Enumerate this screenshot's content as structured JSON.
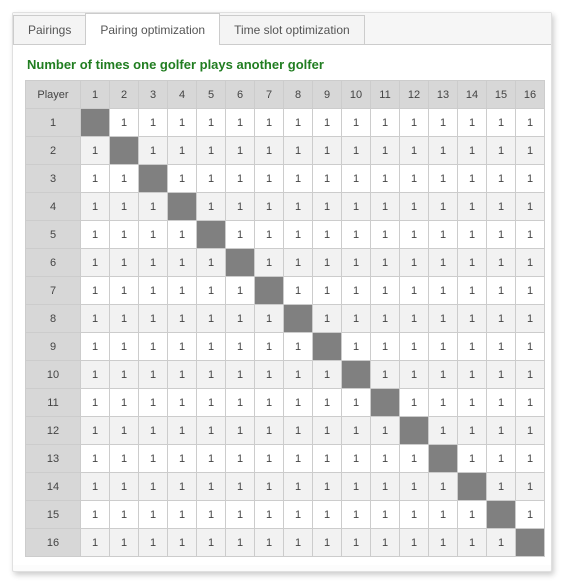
{
  "tabs": [
    {
      "label": "Pairings",
      "active": false
    },
    {
      "label": "Pairing optimization",
      "active": true
    },
    {
      "label": "Time slot optimization",
      "active": false
    }
  ],
  "title": "Number of times one golfer plays another golfer",
  "corner_label": "Player",
  "chart_data": {
    "type": "table",
    "title": "Number of times one golfer plays another golfer",
    "row_labels": [
      1,
      2,
      3,
      4,
      5,
      6,
      7,
      8,
      9,
      10,
      11,
      12,
      13,
      14,
      15,
      16
    ],
    "col_labels": [
      1,
      2,
      3,
      4,
      5,
      6,
      7,
      8,
      9,
      10,
      11,
      12,
      13,
      14,
      15,
      16
    ],
    "values": [
      [
        null,
        1,
        1,
        1,
        1,
        1,
        1,
        1,
        1,
        1,
        1,
        1,
        1,
        1,
        1,
        1
      ],
      [
        1,
        null,
        1,
        1,
        1,
        1,
        1,
        1,
        1,
        1,
        1,
        1,
        1,
        1,
        1,
        1
      ],
      [
        1,
        1,
        null,
        1,
        1,
        1,
        1,
        1,
        1,
        1,
        1,
        1,
        1,
        1,
        1,
        1
      ],
      [
        1,
        1,
        1,
        null,
        1,
        1,
        1,
        1,
        1,
        1,
        1,
        1,
        1,
        1,
        1,
        1
      ],
      [
        1,
        1,
        1,
        1,
        null,
        1,
        1,
        1,
        1,
        1,
        1,
        1,
        1,
        1,
        1,
        1
      ],
      [
        1,
        1,
        1,
        1,
        1,
        null,
        1,
        1,
        1,
        1,
        1,
        1,
        1,
        1,
        1,
        1
      ],
      [
        1,
        1,
        1,
        1,
        1,
        1,
        null,
        1,
        1,
        1,
        1,
        1,
        1,
        1,
        1,
        1
      ],
      [
        1,
        1,
        1,
        1,
        1,
        1,
        1,
        null,
        1,
        1,
        1,
        1,
        1,
        1,
        1,
        1
      ],
      [
        1,
        1,
        1,
        1,
        1,
        1,
        1,
        1,
        null,
        1,
        1,
        1,
        1,
        1,
        1,
        1
      ],
      [
        1,
        1,
        1,
        1,
        1,
        1,
        1,
        1,
        1,
        null,
        1,
        1,
        1,
        1,
        1,
        1
      ],
      [
        1,
        1,
        1,
        1,
        1,
        1,
        1,
        1,
        1,
        1,
        null,
        1,
        1,
        1,
        1,
        1
      ],
      [
        1,
        1,
        1,
        1,
        1,
        1,
        1,
        1,
        1,
        1,
        1,
        null,
        1,
        1,
        1,
        1
      ],
      [
        1,
        1,
        1,
        1,
        1,
        1,
        1,
        1,
        1,
        1,
        1,
        1,
        null,
        1,
        1,
        1
      ],
      [
        1,
        1,
        1,
        1,
        1,
        1,
        1,
        1,
        1,
        1,
        1,
        1,
        1,
        null,
        1,
        1
      ],
      [
        1,
        1,
        1,
        1,
        1,
        1,
        1,
        1,
        1,
        1,
        1,
        1,
        1,
        1,
        null,
        1
      ],
      [
        1,
        1,
        1,
        1,
        1,
        1,
        1,
        1,
        1,
        1,
        1,
        1,
        1,
        1,
        1,
        null
      ]
    ]
  }
}
